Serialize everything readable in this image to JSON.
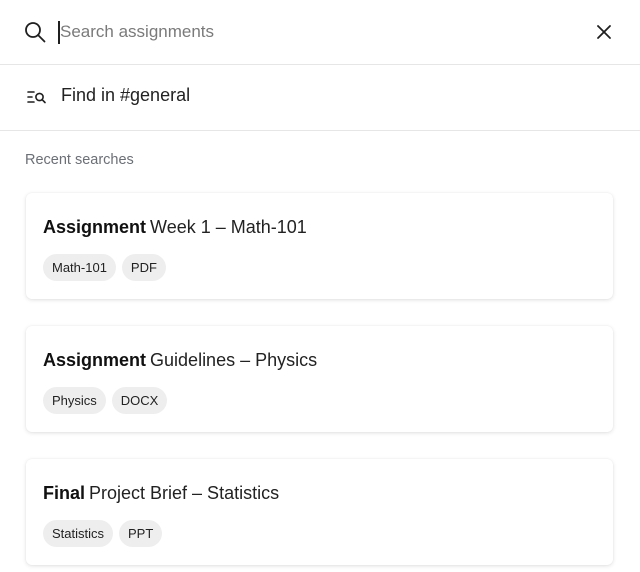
{
  "search": {
    "placeholder": "Search assignments",
    "value": ""
  },
  "find": {
    "label": "Find in #general"
  },
  "recent": {
    "label": "Recent searches",
    "items": [
      {
        "keyword": "Assignment",
        "title": "Week 1 – Math-101",
        "tags": [
          "Math-101",
          "PDF"
        ]
      },
      {
        "keyword": "Assignment",
        "title": "Guidelines – Physics",
        "tags": [
          "Physics",
          "DOCX"
        ]
      },
      {
        "keyword": "Final",
        "title": "Project Brief – Statistics",
        "tags": [
          "Statistics",
          "PPT"
        ]
      }
    ]
  },
  "icons": {
    "search": "search-icon",
    "close": "close-icon",
    "find": "find-in-channel-icon"
  }
}
